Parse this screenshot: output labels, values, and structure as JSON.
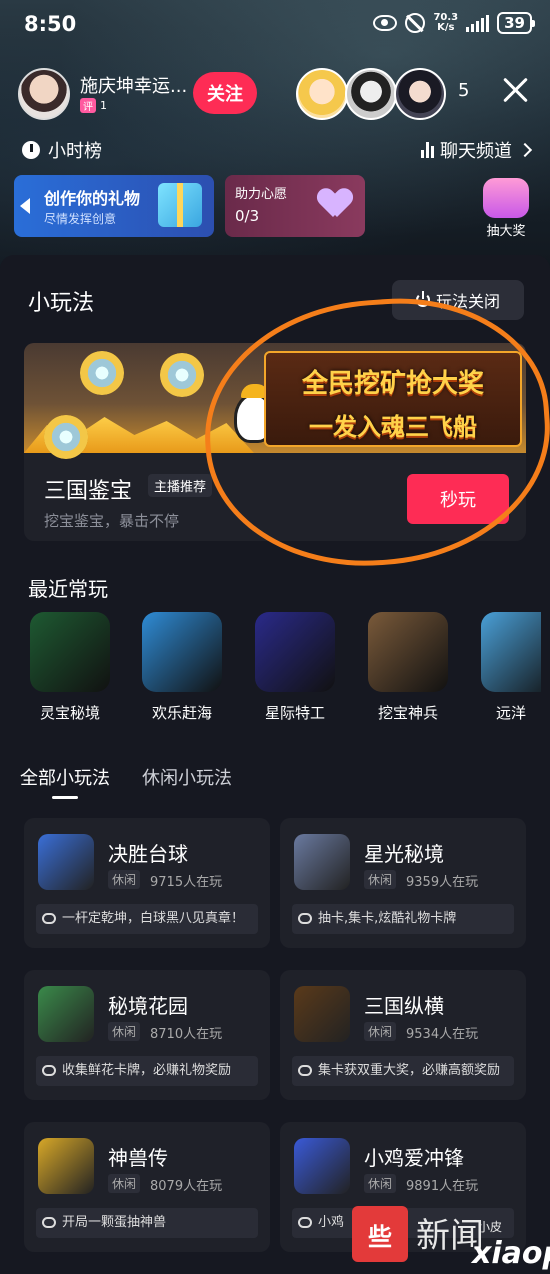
{
  "status_bar": {
    "time": "8:50",
    "net_speed_value": "70.3",
    "net_speed_unit": "K/s",
    "battery": "39"
  },
  "host": {
    "name": "施庆坤幸运...",
    "badge_tag": "评",
    "badge_level": "1",
    "follow_label": "关注"
  },
  "viewers": {
    "count": "5"
  },
  "rank": {
    "label": "小时榜"
  },
  "chat_channel": {
    "label": "聊天频道"
  },
  "gift_banner": {
    "title": "创作你的礼物",
    "subtitle": "尽情发挥创意"
  },
  "wish": {
    "title": "助力心愿",
    "progress": "0/3"
  },
  "lottery": {
    "label": "抽大奖"
  },
  "panel": {
    "title": "小玩法",
    "off_label": "玩法关闭"
  },
  "featured": {
    "name": "三国鉴宝",
    "tag": "主播推荐",
    "desc": "挖宝鉴宝，暴击不停",
    "promo_line1": "全民挖矿抢大奖",
    "promo_line2": "一发入魂三飞船",
    "play_label": "秒玩"
  },
  "recent": {
    "title": "最近常玩",
    "items": [
      {
        "label": "灵宝秘境",
        "color": "#1e5a32"
      },
      {
        "label": "欢乐赶海",
        "color": "#2f8cd6"
      },
      {
        "label": "星际特工",
        "color": "#2a2a8a"
      },
      {
        "label": "挖宝神兵",
        "color": "#7a5a3a"
      },
      {
        "label": "远洋",
        "color": "#4aa0d8"
      }
    ]
  },
  "tabs": [
    {
      "label": "全部小玩法"
    },
    {
      "label": "休闲小玩法"
    }
  ],
  "games": [
    {
      "name": "决胜台球",
      "tag": "休闲",
      "players": "9715人在玩",
      "desc": "一杆定乾坤，白球黑八见真章！",
      "color": "#3a6fd8"
    },
    {
      "name": "星光秘境",
      "tag": "休闲",
      "players": "9359人在玩",
      "desc": "抽卡,集卡,炫酷礼物卡牌",
      "color": "#6a7aa0"
    },
    {
      "name": "秘境花园",
      "tag": "休闲",
      "players": "8710人在玩",
      "desc": "收集鲜花卡牌，必赚礼物奖励",
      "color": "#3a8a4a"
    },
    {
      "name": "三国纵横",
      "tag": "休闲",
      "players": "9534人在玩",
      "desc": "集卡获双重大奖，必赚高额奖励",
      "color": "#5a3a1a"
    },
    {
      "name": "神兽传",
      "tag": "休闲",
      "players": "8079人在玩",
      "desc": "开局一颗蛋抽神兽",
      "color": "#d8a828"
    },
    {
      "name": "小鸡爱冲锋",
      "tag": "休闲",
      "players": "9891人在玩",
      "desc": "小鸡",
      "color": "#3a5ad8"
    }
  ],
  "watermark": {
    "box": "些",
    "text": "新闻",
    "small": "小皮",
    "brand": "xiaopi"
  },
  "colors": {
    "accent": "#fe2c55",
    "highlight_circle": "#f57e1a",
    "panel_bg": "#161821",
    "card_bg": "#1f2129"
  }
}
